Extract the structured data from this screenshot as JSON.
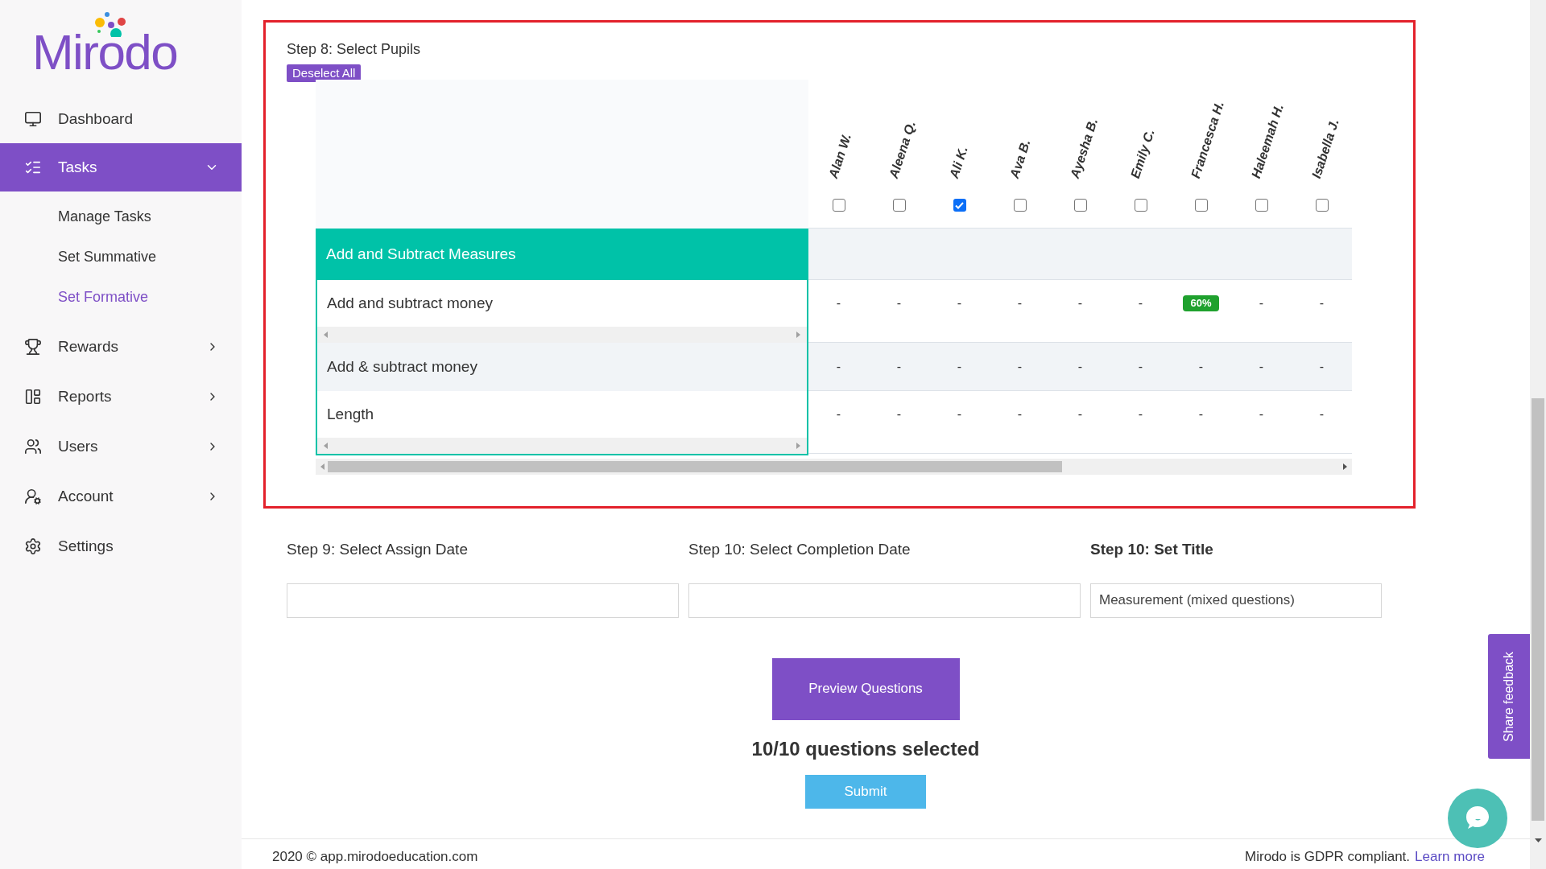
{
  "logo": {
    "text": "Mirodo"
  },
  "sidebar": {
    "items": [
      {
        "label": "Dashboard",
        "kind": "link",
        "selected": false
      },
      {
        "label": "Tasks",
        "kind": "group",
        "expanded": true,
        "selected": true,
        "children": [
          {
            "label": "Manage Tasks",
            "selected": false
          },
          {
            "label": "Set Summative",
            "selected": false
          },
          {
            "label": "Set Formative",
            "selected": true
          }
        ]
      },
      {
        "label": "Rewards",
        "kind": "group",
        "expanded": false,
        "selected": false
      },
      {
        "label": "Reports",
        "kind": "group",
        "expanded": false,
        "selected": false
      },
      {
        "label": "Users",
        "kind": "group",
        "expanded": false,
        "selected": false
      },
      {
        "label": "Account",
        "kind": "group",
        "expanded": false,
        "selected": false
      },
      {
        "label": "Settings",
        "kind": "link",
        "selected": false
      }
    ]
  },
  "step8": {
    "title": "Step 8: Select Pupils",
    "deselect_button": "Deselect All",
    "pupils": [
      {
        "name": "Alan W.",
        "checked": false
      },
      {
        "name": "Aleena Q.",
        "checked": false
      },
      {
        "name": "Ali K.",
        "checked": true
      },
      {
        "name": "Ava B.",
        "checked": false
      },
      {
        "name": "Ayesha B.",
        "checked": false
      },
      {
        "name": "Emily C.",
        "checked": false
      },
      {
        "name": "Francesca H.",
        "checked": false
      },
      {
        "name": "Haleemah H.",
        "checked": false
      },
      {
        "name": "Isabella J.",
        "checked": false
      }
    ],
    "rows": [
      {
        "kind": "section",
        "label": "Add and Subtract Measures"
      },
      {
        "kind": "topic",
        "label": "Add and subtract money",
        "scroll": true,
        "cells": [
          "-",
          "-",
          "-",
          "-",
          "-",
          "-",
          "60%",
          "-",
          "-"
        ],
        "badges": [
          false,
          false,
          false,
          false,
          false,
          false,
          true,
          false,
          false
        ]
      },
      {
        "kind": "topic",
        "label": "Add & subtract money",
        "scroll": false,
        "shaded": true,
        "cells": [
          "-",
          "-",
          "-",
          "-",
          "-",
          "-",
          "-",
          "-",
          "-"
        ],
        "badges": [
          false,
          false,
          false,
          false,
          false,
          false,
          false,
          false,
          false
        ]
      },
      {
        "kind": "topic",
        "label": "Length",
        "scroll": true,
        "cells": [
          "-",
          "-",
          "-",
          "-",
          "-",
          "-",
          "-",
          "-",
          "-"
        ],
        "badges": [
          false,
          false,
          false,
          false,
          false,
          false,
          false,
          false,
          false
        ]
      }
    ]
  },
  "step9": {
    "label": "Step 9: Select Assign Date"
  },
  "step10_date": {
    "label": "Step 10: Select Completion Date"
  },
  "step10_title": {
    "label": "Step 10: Set Title",
    "value": "Measurement (mixed questions)"
  },
  "preview_button": "Preview Questions",
  "selected_count": "10/10 questions selected",
  "submit_button": "Submit",
  "feedback_tab": "Share feedback",
  "footer": {
    "copyright": "2020 © app.mirodoeducation.com",
    "gdpr": "Mirodo is GDPR compliant.",
    "link": "Learn more"
  }
}
